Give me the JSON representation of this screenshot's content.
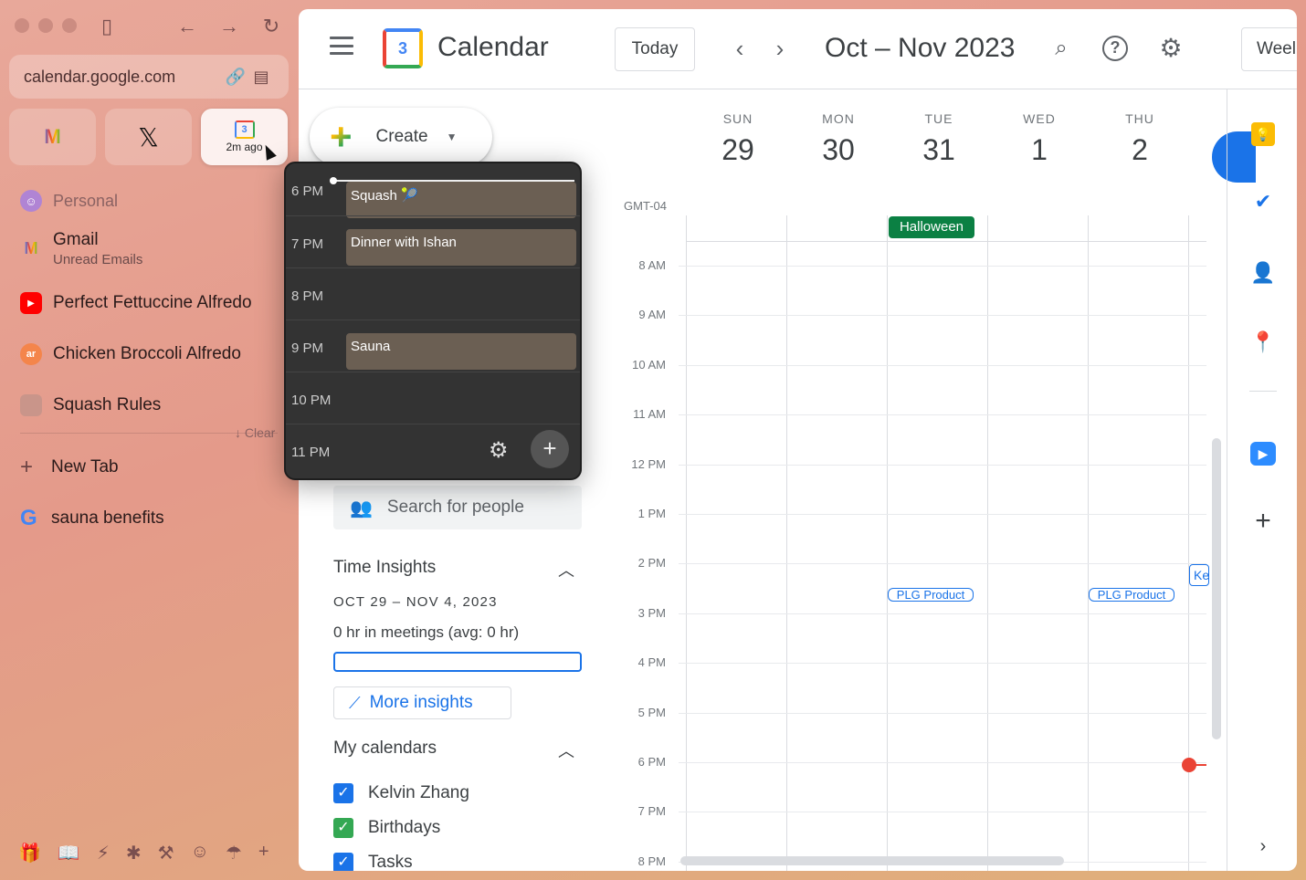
{
  "browser": {
    "url": "calendar.google.com",
    "pinned": [
      {
        "name": "Gmail",
        "label": ""
      },
      {
        "name": "X",
        "label": ""
      },
      {
        "name": "Calendar",
        "label": "2m ago"
      }
    ],
    "calendar_pin_number": "3",
    "section": "Personal",
    "tabs": [
      {
        "title": "Gmail",
        "subtitle": "Unread Emails",
        "icon_text": "M",
        "color": "#ea4335"
      },
      {
        "title": "Perfect Fettuccine Alfredo",
        "icon_text": "▶",
        "color": "#ff0000"
      },
      {
        "title": "Chicken Broccoli Alfredo",
        "icon_text": "ar",
        "color": "#f4854b"
      },
      {
        "title": "Squash Rules",
        "icon_text": "",
        "color": "#c9958a"
      }
    ],
    "clear_label": "↓ Clear",
    "new_tab_label": "New Tab",
    "google_tab": "sauna benefits"
  },
  "calendar": {
    "app_title": "Calendar",
    "logo_number": "3",
    "today_label": "Today",
    "date_range": "Oct – Nov 2023",
    "view_label": "Weel",
    "create_label": "Create",
    "timezone": "GMT-04",
    "days": [
      {
        "name": "SUN",
        "num": "29"
      },
      {
        "name": "MON",
        "num": "30"
      },
      {
        "name": "TUE",
        "num": "31"
      },
      {
        "name": "WED",
        "num": "1"
      },
      {
        "name": "THU",
        "num": "2"
      }
    ],
    "hours": [
      "8 AM",
      "9 AM",
      "10 AM",
      "11 AM",
      "12 PM",
      "1 PM",
      "2 PM",
      "3 PM",
      "4 PM",
      "5 PM",
      "6 PM",
      "7 PM",
      "8 PM"
    ],
    "all_day_event": "Halloween",
    "events": [
      "PLG Product",
      "PLG Product"
    ],
    "partial_event": "Ke",
    "search_people_placeholder": "Search for people",
    "time_insights": {
      "title": "Time Insights",
      "range": "OCT 29 – NOV 4, 2023",
      "meetings": "0 hr in meetings (avg: 0 hr)",
      "more_label": "More insights"
    },
    "my_calendars": {
      "title": "My calendars",
      "items": [
        {
          "name": "Kelvin Zhang",
          "color": "#1a73e8"
        },
        {
          "name": "Birthdays",
          "color": "#34a853"
        },
        {
          "name": "Tasks",
          "color": "#1a73e8"
        }
      ]
    }
  },
  "popup": {
    "rows": [
      {
        "time": "6 PM",
        "event": "Squash 🎾"
      },
      {
        "time": "7 PM",
        "event": "Dinner with Ishan"
      },
      {
        "time": "8 PM",
        "event": ""
      },
      {
        "time": "9 PM",
        "event": "Sauna"
      },
      {
        "time": "10 PM",
        "event": ""
      },
      {
        "time": "11 PM",
        "event": ""
      }
    ]
  }
}
